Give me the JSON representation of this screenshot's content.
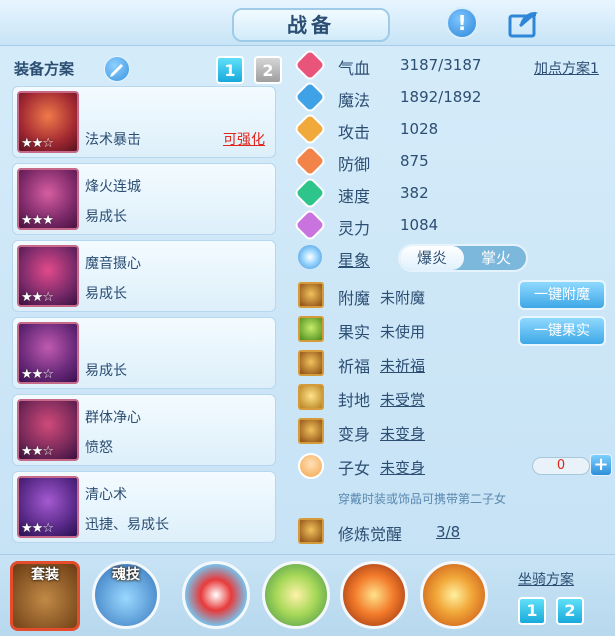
{
  "window": {
    "title": "战备"
  },
  "equip_plan": {
    "label": "装备方案",
    "plan_buttons": [
      "1",
      "2"
    ],
    "active_plan": "1",
    "items": [
      {
        "line1": "",
        "line2": "法术暴击",
        "action": "可强化",
        "stars_filled": 2,
        "stars_total": 3
      },
      {
        "line1": "烽火连城",
        "line2": "易成长",
        "action": "",
        "stars_filled": 3,
        "stars_total": 3
      },
      {
        "line1": "魔音摄心",
        "line2": "易成长",
        "action": "",
        "stars_filled": 2,
        "stars_total": 3
      },
      {
        "line1": "",
        "line2": "易成长",
        "action": "",
        "stars_filled": 2,
        "stars_total": 3
      },
      {
        "line1": "群体净心",
        "line2": "愤怒",
        "action": "",
        "stars_filled": 2,
        "stars_total": 3
      },
      {
        "line1": "清心术",
        "line2": "迅捷、易成长",
        "action": "",
        "stars_filled": 2,
        "stars_total": 3
      }
    ]
  },
  "stats": {
    "add_point_plan": "加点方案1",
    "rows": [
      {
        "name": "气血",
        "value": "3187/3187",
        "icon": "heart-icon",
        "color": "#e8547a"
      },
      {
        "name": "魔法",
        "value": "1892/1892",
        "icon": "water-drop-icon",
        "color": "#3fa2e6"
      },
      {
        "name": "攻击",
        "value": "1028",
        "icon": "sword-icon",
        "color": "#f2a93b"
      },
      {
        "name": "防御",
        "value": "875",
        "icon": "shield-icon",
        "color": "#f2844a"
      },
      {
        "name": "速度",
        "value": "382",
        "icon": "speed-icon",
        "color": "#2ec58a"
      },
      {
        "name": "灵力",
        "value": "1084",
        "icon": "spirit-icon",
        "color": "#c873de"
      }
    ]
  },
  "constellation": {
    "label": "星象",
    "options": [
      "爆炎",
      "掌火"
    ],
    "selected": "爆炎"
  },
  "enhance": {
    "rows": [
      {
        "name": "附魔",
        "value": "未附魔",
        "underline": false,
        "icon": "enchant-icon",
        "button": "一键附魔"
      },
      {
        "name": "果实",
        "value": "未使用",
        "underline": false,
        "icon": "fruit-icon",
        "button": "一键果实"
      },
      {
        "name": "祈福",
        "value": "未祈福",
        "underline": true,
        "icon": "blessing-icon",
        "button": ""
      },
      {
        "name": "封地",
        "value": "未受赏",
        "underline": true,
        "icon": "fief-icon",
        "button": ""
      },
      {
        "name": "变身",
        "value": "未变身",
        "underline": true,
        "icon": "transform-icon",
        "button": ""
      }
    ],
    "child": {
      "name": "子女",
      "value": "未变身",
      "count": "0"
    },
    "hint": "穿戴时装或饰品可携带第二子女",
    "awaken": {
      "name": "修炼觉醒",
      "value": "3/8"
    }
  },
  "bottom": {
    "suit_label": "套装",
    "soul_skill_label": "魂技",
    "mount_label": "坐骑方案",
    "mount_buttons": [
      "1",
      "2"
    ]
  },
  "colors": {
    "accent": "#17a9dc",
    "warning": "#e0261d"
  }
}
